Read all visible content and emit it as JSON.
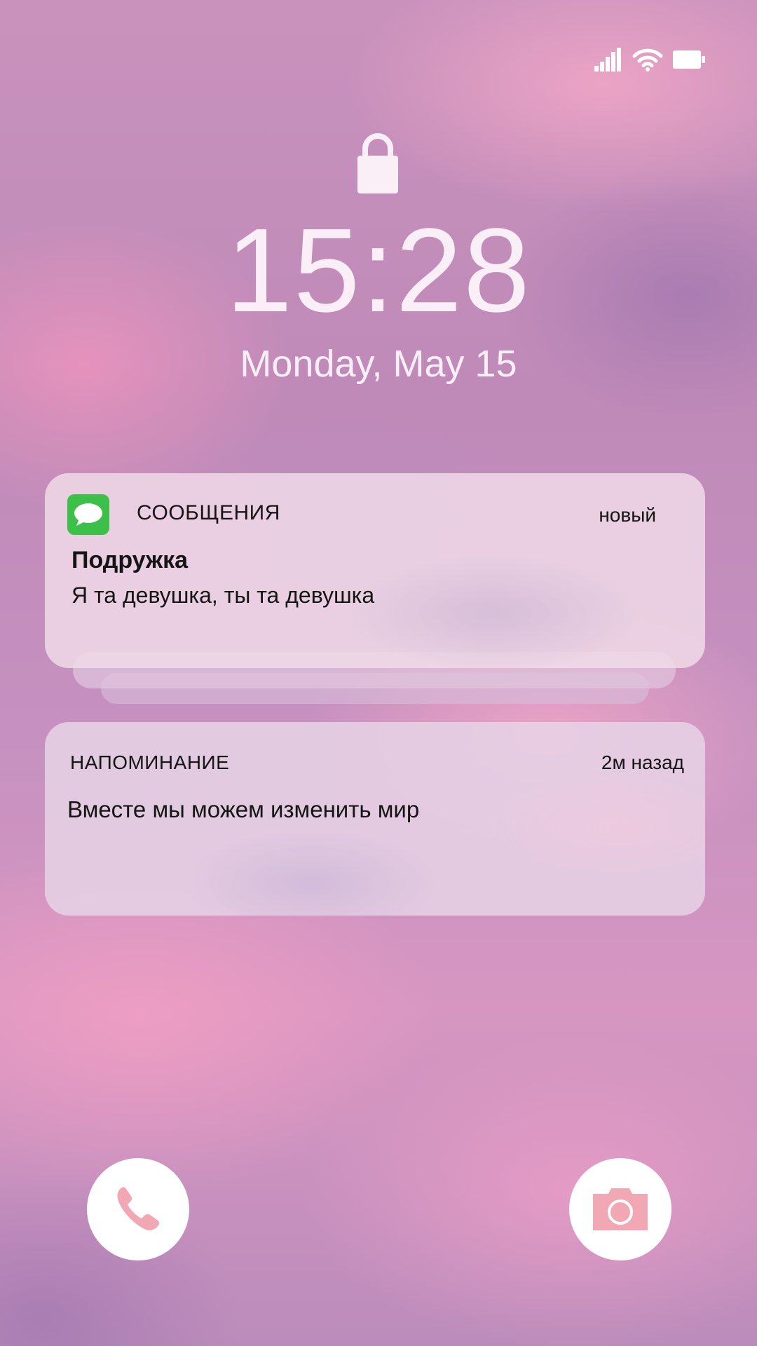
{
  "status_bar": {
    "signal_icon": "cellular-signal-icon",
    "wifi_icon": "wifi-icon",
    "battery_icon": "battery-icon"
  },
  "lock_screen": {
    "lock_icon": "lock-icon",
    "time": "15:28",
    "date": "Monday, May 15"
  },
  "notifications": [
    {
      "app_icon": "messages-icon",
      "app_name": "СООБЩЕНИЯ",
      "time": "новый",
      "title": "Подружка",
      "body": "Я та девушка, ты та девушка"
    },
    {
      "app_name": "НАПОМИНАНИЕ",
      "time": "2м назад",
      "body": "Вместе мы можем изменить мир"
    }
  ],
  "quick_actions": {
    "phone_icon": "phone-icon",
    "camera_icon": "camera-icon"
  },
  "colors": {
    "accent_pink": "#f2a7b5",
    "messages_green": "#3cc04a",
    "text_light": "#fbeff7"
  }
}
